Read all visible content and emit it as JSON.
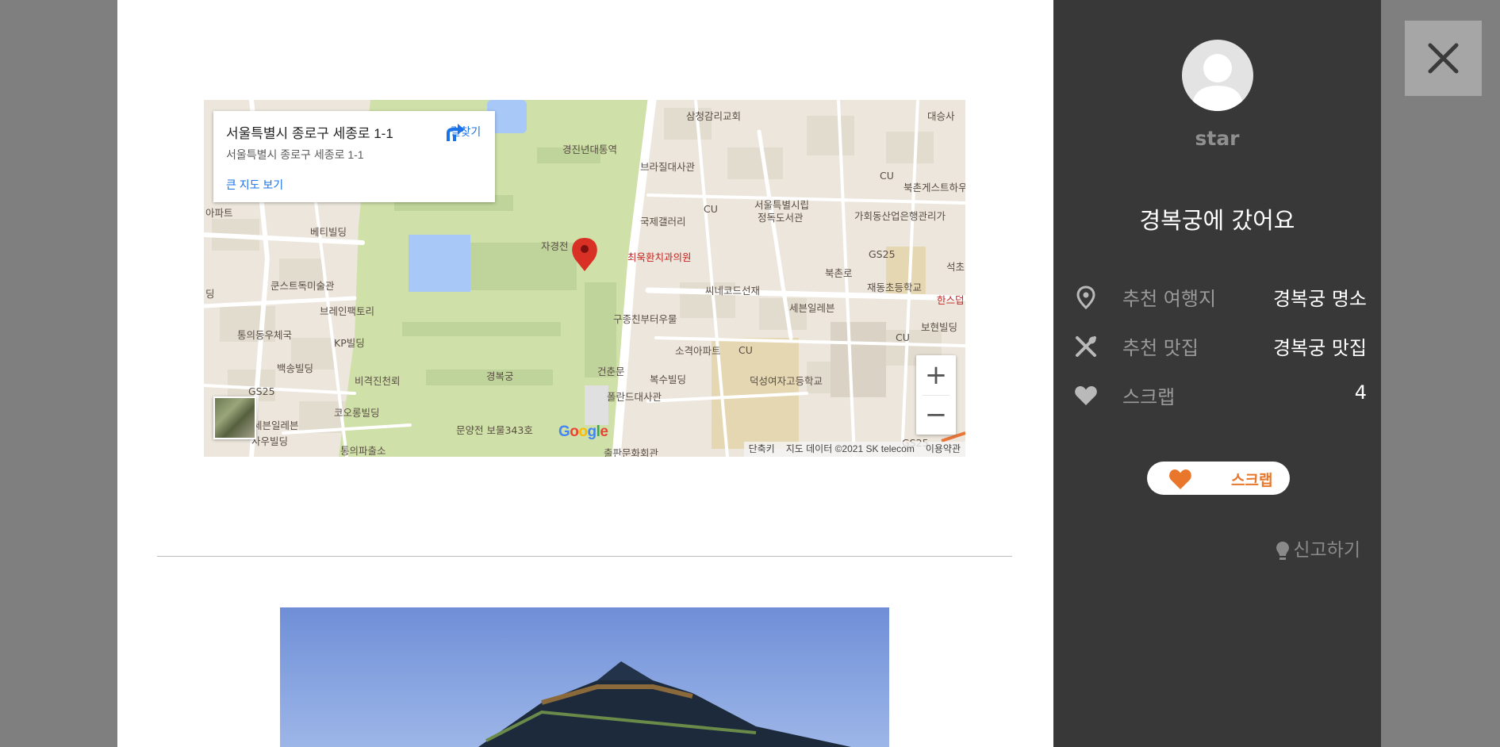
{
  "map": {
    "place_title": "서울특별시 종로구 세종로 1-1",
    "place_address": "서울특별시 종로구 세종로 1-1",
    "directions_label": "길찾기",
    "view_larger_map": "큰 지도 보기",
    "zoom_in": "+",
    "zoom_out": "−",
    "google_logo": "Google",
    "attribution": {
      "shortcuts": "단축키",
      "map_data": "지도 데이터 ©2021 SK telecom",
      "terms": "이용약관"
    },
    "labels": [
      "삼청감리교회",
      "대승사",
      "경진년대통역",
      "브라질대사관",
      "CU",
      "북촌게스트하우",
      "서울특별시립",
      "정독도서관",
      "가회동산업은행관리가",
      "국제갤러리",
      "CU",
      "자경전",
      "최욱환치과의원",
      "GS25",
      "석초",
      "북촌로",
      "재동초등학교",
      "한스덥",
      "씨네코드선재",
      "세븐일레븐",
      "보현빌딩",
      "구종친부터우물",
      "CU",
      "소격아파트",
      "CU",
      "건춘문",
      "복수빌딩",
      "덕성여자고등학교",
      "폴란드대사관",
      "경복궁",
      "문양전 보물343호",
      "출판문화회관",
      "GS25",
      "베티빌딩",
      "쿤스트독미술관",
      "브레인팩토리",
      "통의동우체국",
      "KP빌딩",
      "백송빌딩",
      "비격진천뢰",
      "GS25",
      "코오롱빌딩",
      "세븐일레븐",
      "사우빌딩",
      "통의파출소",
      "아파트",
      "딩"
    ]
  },
  "sidebar": {
    "username": "star",
    "post_title": "경복궁에 갔어요",
    "rows": [
      {
        "label": "추천 여행지",
        "value": "경복궁 명소",
        "icon": "location-pin-icon"
      },
      {
        "label": "추천 맛집",
        "value": "경복궁 맛집",
        "icon": "fork-knife-icon"
      },
      {
        "label": "스크랩",
        "value": "4",
        "icon": "heart-icon"
      }
    ],
    "scrap_button_label": "스크랩",
    "report_label": "신고하기"
  },
  "colors": {
    "overlay": "#7f7f7f",
    "panel": "#383838",
    "accent": "#e8762b",
    "map_park": "#cfe0a8",
    "map_water": "#a8c8f8",
    "pin": "#d93025"
  }
}
